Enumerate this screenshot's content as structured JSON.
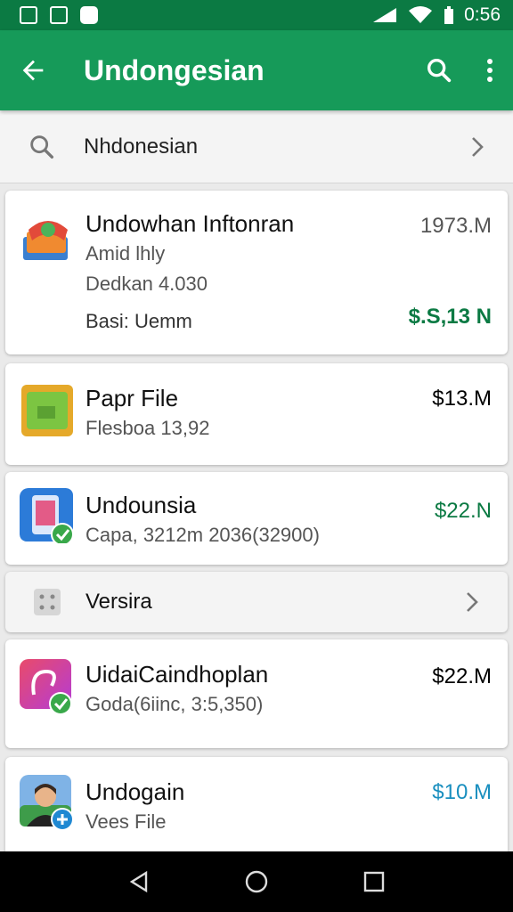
{
  "status": {
    "time": "0:56",
    "battery_label": "0:56"
  },
  "appbar": {
    "title": "Undongesian",
    "icons": [
      "back-arrow-icon",
      "search-icon",
      "more-vert-icon"
    ]
  },
  "search": {
    "text": "Nhdonesian"
  },
  "items": [
    {
      "title": "Undowhan Inftonran",
      "line2": "Amid lhly",
      "line3": "Dedkan 4.030",
      "line4": "Basi: Uemm",
      "size": "1973.M",
      "price": "$.S,13 N",
      "price_color": "#0b7a43"
    },
    {
      "title": "Papr File",
      "line2": "Flesboa 13,92",
      "price": "$13.M",
      "price_color": "#555555"
    },
    {
      "title": "Undounsia",
      "line2": "Capa, 3212m 2036(32900)",
      "price": "$22.N",
      "price_color": "#0b7a43"
    },
    {
      "title": "UidaiCaindhoplan",
      "line2": "Goda(6iinc, 3:5,350)",
      "price": "$22.M",
      "price_color": "#555555"
    },
    {
      "title": "Undogain",
      "line2": "Vees File",
      "price": "$10.M",
      "price_color": "#1a8fbf"
    }
  ],
  "section": {
    "label": "Versira"
  }
}
